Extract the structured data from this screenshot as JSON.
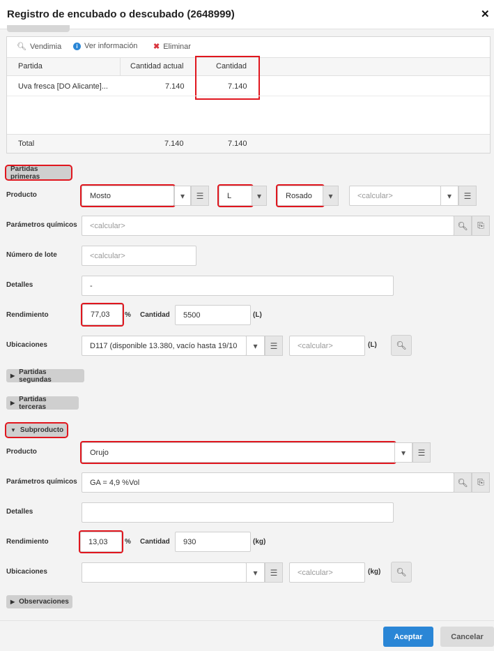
{
  "title": "Registro de encubado o descubado (2648999)",
  "toolbar": {
    "vendimia": "Vendimia",
    "info": "Ver información",
    "delete": "Eliminar"
  },
  "grid": {
    "headers": [
      "Partida",
      "Cantidad actual",
      "Cantidad"
    ],
    "rows": [
      {
        "partida": "Uva fresca [DO Alicante]...",
        "actual": "7.140",
        "cantidad": "7.140"
      }
    ],
    "total": {
      "label": "Total",
      "actual": "7.140",
      "cantidad": "7.140"
    }
  },
  "primeras": {
    "section": "Partidas primeras",
    "producto_label": "Producto",
    "producto": "Mosto",
    "unidad": "L",
    "tipo": "Rosado",
    "extra_placeholder": "<calcular>",
    "parametros_label": "Parámetros químicos",
    "parametros_placeholder": "<calcular>",
    "lote_label": "Número de lote",
    "lote_placeholder": "<calcular>",
    "detalles_label": "Detalles",
    "detalles": "-",
    "rendimiento_label": "Rendimiento",
    "rendimiento": "77,03",
    "pct": "%",
    "cantidad_label": "Cantidad",
    "cantidad": "5500",
    "cantidad_unit": "(L)",
    "ubicaciones_label": "Ubicaciones",
    "ubicacion": "D117 (disponible 13.380, vacío hasta 19/10",
    "ubic_qty_placeholder": "<calcular>",
    "ubic_unit": "(L)"
  },
  "segundas": "Partidas segundas",
  "terceras": "Partidas terceras",
  "subproducto": {
    "section": "Subproducto",
    "producto_label": "Producto",
    "producto": "Orujo",
    "parametros_label": "Parámetros químicos",
    "parametros": "GA = 4,9 %Vol",
    "detalles_label": "Detalles",
    "detalles": "",
    "rendimiento_label": "Rendimiento",
    "rendimiento": "13,03",
    "pct": "%",
    "cantidad_label": "Cantidad",
    "cantidad": "930",
    "cantidad_unit": "(kg)",
    "ubicaciones_label": "Ubicaciones",
    "ubicacion": "",
    "ubic_qty_placeholder": "<calcular>",
    "ubic_unit": "(kg)"
  },
  "observaciones": "Observaciones",
  "buttons": {
    "accept": "Aceptar",
    "cancel": "Cancelar"
  },
  "colors": {
    "accent": "#2a86d6",
    "highlight": "#e0161e",
    "delete": "#d9363e",
    "info": "#2a86d6"
  }
}
